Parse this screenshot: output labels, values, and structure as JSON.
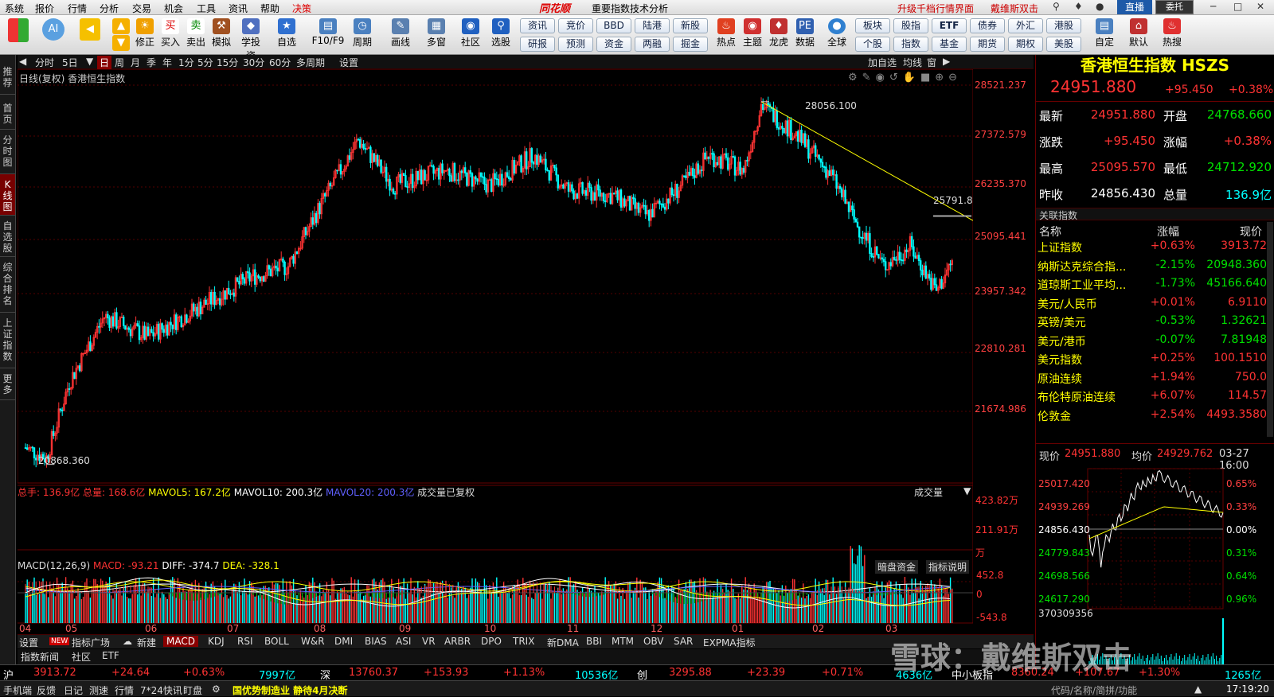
{
  "menu": {
    "items": [
      "系统",
      "报价",
      "行情",
      "分析",
      "交易",
      "机会",
      "工具",
      "资讯",
      "帮助",
      "决策"
    ],
    "logo": "同花顺",
    "title": "重要指数技术分析",
    "upgrade": "升级千档行情界面",
    "user": "戴维斯双击",
    "live": "直播",
    "trust": "委托"
  },
  "toolbar": {
    "buttons": [
      "修正",
      "买入",
      "卖出",
      "模拟",
      "学投资",
      "自选",
      "F10/F9",
      "周期",
      "画线",
      "多窗",
      "社区",
      "选股"
    ],
    "grid_row1": [
      "资讯",
      "竞价",
      "BBD",
      "陆港",
      "新股"
    ],
    "grid_row2": [
      "研报",
      "预测",
      "资金",
      "两融",
      "掘金"
    ],
    "right_row": [
      "热点",
      "主题",
      "龙虎",
      "数据",
      "全球"
    ],
    "grid2_row1": [
      "板块",
      "股指",
      "ETF",
      "债券",
      "外汇",
      "港股"
    ],
    "grid2_row2": [
      "个股",
      "指数",
      "基金",
      "期货",
      "期权",
      "美股"
    ],
    "far": [
      "自定",
      "默认",
      "热搜"
    ]
  },
  "left_tabs": [
    "推荐",
    "首页",
    "分时图",
    "K线图",
    "自选股",
    "综合排名",
    "上证指数",
    "更多"
  ],
  "period_tabs": [
    "分时",
    "5日",
    "日",
    "周",
    "月",
    "季",
    "年",
    "1分",
    "5分",
    "15分",
    "30分",
    "60分",
    "多周期",
    "设置"
  ],
  "period_right": [
    "加自选",
    "均线",
    "窗"
  ],
  "chart_info": "日线(复权) 香港恒生指数",
  "high_label": "28056.100",
  "low_label": "20868.360",
  "line_label": "25791.8",
  "yaxis": [
    "28521.237",
    "27372.579",
    "26235.370",
    "25095.441",
    "23957.342",
    "22810.281",
    "21674.986"
  ],
  "vol_header": {
    "zs": "总手: 136.9亿",
    "zl": "总量: 168.6亿",
    "m5": "MAVOL5: 167.2亿",
    "m10": "MAVOL10: 200.3亿",
    "m20": "MAVOL20: 200.3亿",
    "fq": "成交量已复权",
    "sel": "成交量"
  },
  "vol_axis": [
    "423.82万",
    "211.91万",
    "万"
  ],
  "macd_header": {
    "name": "MACD(12,26,9)",
    "macd": "MACD: -93.21",
    "diff": "DIFF: -374.7",
    "dea": "DEA: -328.1",
    "btn1": "暗盘资金",
    "btn2": "指标说明"
  },
  "macd_axis": [
    "452.8",
    "0",
    "-543.8"
  ],
  "months": [
    "04",
    "05",
    "06",
    "07",
    "08",
    "09",
    "10",
    "11",
    "12",
    "01",
    "02",
    "03"
  ],
  "indicators": [
    "设置",
    "指标广场",
    "新建",
    "MACD",
    "KDJ",
    "RSI",
    "BOLL",
    "W&R",
    "DMI",
    "BIAS",
    "ASI",
    "VR",
    "ARBR",
    "DPO",
    "TRIX",
    "新DMA",
    "BBI",
    "MTM",
    "OBV",
    "SAR",
    "EXPMA指标"
  ],
  "indicators_new": "NEW",
  "sub_tabs": [
    "指数新闻",
    "社区",
    "ETF"
  ],
  "rp": {
    "title": "香港恒生指数 HSZS",
    "price": "24951.880",
    "chg": "+95.450",
    "pct": "+0.38%",
    "rows": [
      [
        "最新",
        "24951.880",
        "开盘",
        "24768.660"
      ],
      [
        "涨跌",
        "+95.450",
        "涨幅",
        "+0.38%"
      ],
      [
        "最高",
        "25095.570",
        "最低",
        "24712.920"
      ],
      [
        "昨收",
        "24856.430",
        "总量",
        "136.9亿"
      ]
    ],
    "rel_title": "关联指数",
    "rel_head": [
      "名称",
      "涨幅",
      "现价"
    ],
    "rel": [
      [
        "上证指数",
        "+0.63%",
        "3913.72"
      ],
      [
        "纳斯达克综合指...",
        "-2.15%",
        "20948.360"
      ],
      [
        "道琼斯工业平均...",
        "-1.73%",
        "45166.640"
      ],
      [
        "美元/人民币",
        "+0.01%",
        "6.9110"
      ],
      [
        "英镑/美元",
        "-0.53%",
        "1.32621"
      ],
      [
        "美元/港币",
        "-0.07%",
        "7.81948"
      ],
      [
        "美元指数",
        "+0.25%",
        "100.1510"
      ],
      [
        "原油连续",
        "+1.94%",
        "750.0"
      ],
      [
        "布伦特原油连续",
        "+6.07%",
        "114.57"
      ],
      [
        "伦敦金",
        "+2.54%",
        "4493.3580"
      ]
    ],
    "mini_head": {
      "now_lbl": "现价",
      "now": "24951.880",
      "avg_lbl": "均价",
      "avg": "24929.762",
      "date": "03-27 16:00"
    },
    "mini_y": [
      "25017.420",
      "24939.269",
      "24856.430",
      "24779.843",
      "24698.566",
      "24617.290",
      "370309356"
    ],
    "mini_pct": [
      "0.65%",
      "0.33%",
      "0.00%",
      "0.31%",
      "0.64%",
      "0.96%"
    ]
  },
  "status": {
    "sh": "沪",
    "sh_v": "3913.72",
    "sh_c": "+24.64",
    "sh_p": "+0.63%",
    "sh_a": "7997亿",
    "sz": "深",
    "sz_v": "13760.37",
    "sz_c": "+153.93",
    "sz_p": "+1.13%",
    "sz_a": "10536亿",
    "cy": "创",
    "cy_v": "3295.88",
    "cy_c": "+23.39",
    "cy_p": "+0.71%",
    "cy_a": "4636亿",
    "zx": "中小板指",
    "zx_v": "8360.24",
    "zx_c": "+107.67",
    "zx_p": "+1.30%",
    "zx_a": "1265亿"
  },
  "bottom": {
    "items": [
      "手机端",
      "反馈",
      "日记",
      "测速",
      "行情",
      "7*24快讯",
      "盯盘"
    ],
    "news": "国优势制造业 静待4月决断",
    "search": "代码/名称/简拼/功能",
    "time": "17:19:20"
  },
  "watermark": "雪球：戴维斯双击",
  "colors": {
    "up": "#ff3333",
    "down": "#00ffff",
    "bg": "#000000"
  }
}
